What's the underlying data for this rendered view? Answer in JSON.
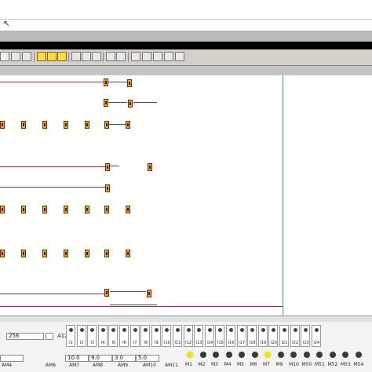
{
  "panel": {
    "field_value": "256",
    "a12_label": "A12",
    "inputs": [
      "I1",
      "I2",
      "I3",
      "I4",
      "I5",
      "I6",
      "I7",
      "I8",
      "I9",
      "I10",
      "I11",
      "I12",
      "I13",
      "I14",
      "I15",
      "I16",
      "I17",
      "I18",
      "I19",
      "I20",
      "I21",
      "I22",
      "I23",
      "I24"
    ],
    "analog_values": [
      "10.0",
      "9.0",
      "3.0",
      "5.0"
    ],
    "am_labels": [
      "AM4",
      "AM6",
      "AM7",
      "AM8",
      "AM9",
      "AM10",
      "AM11"
    ],
    "markers": [
      "M1",
      "M2",
      "M3",
      "M4",
      "M5",
      "M6",
      "M7",
      "M9",
      "M10",
      "M50",
      "M51",
      "M52",
      "M53",
      "M54"
    ]
  },
  "colors": {
    "bulb_on": "#f4e11a",
    "bulb_off": "#3a3a3a",
    "block": "#f2a623",
    "ruler": "#3e9a5e"
  }
}
